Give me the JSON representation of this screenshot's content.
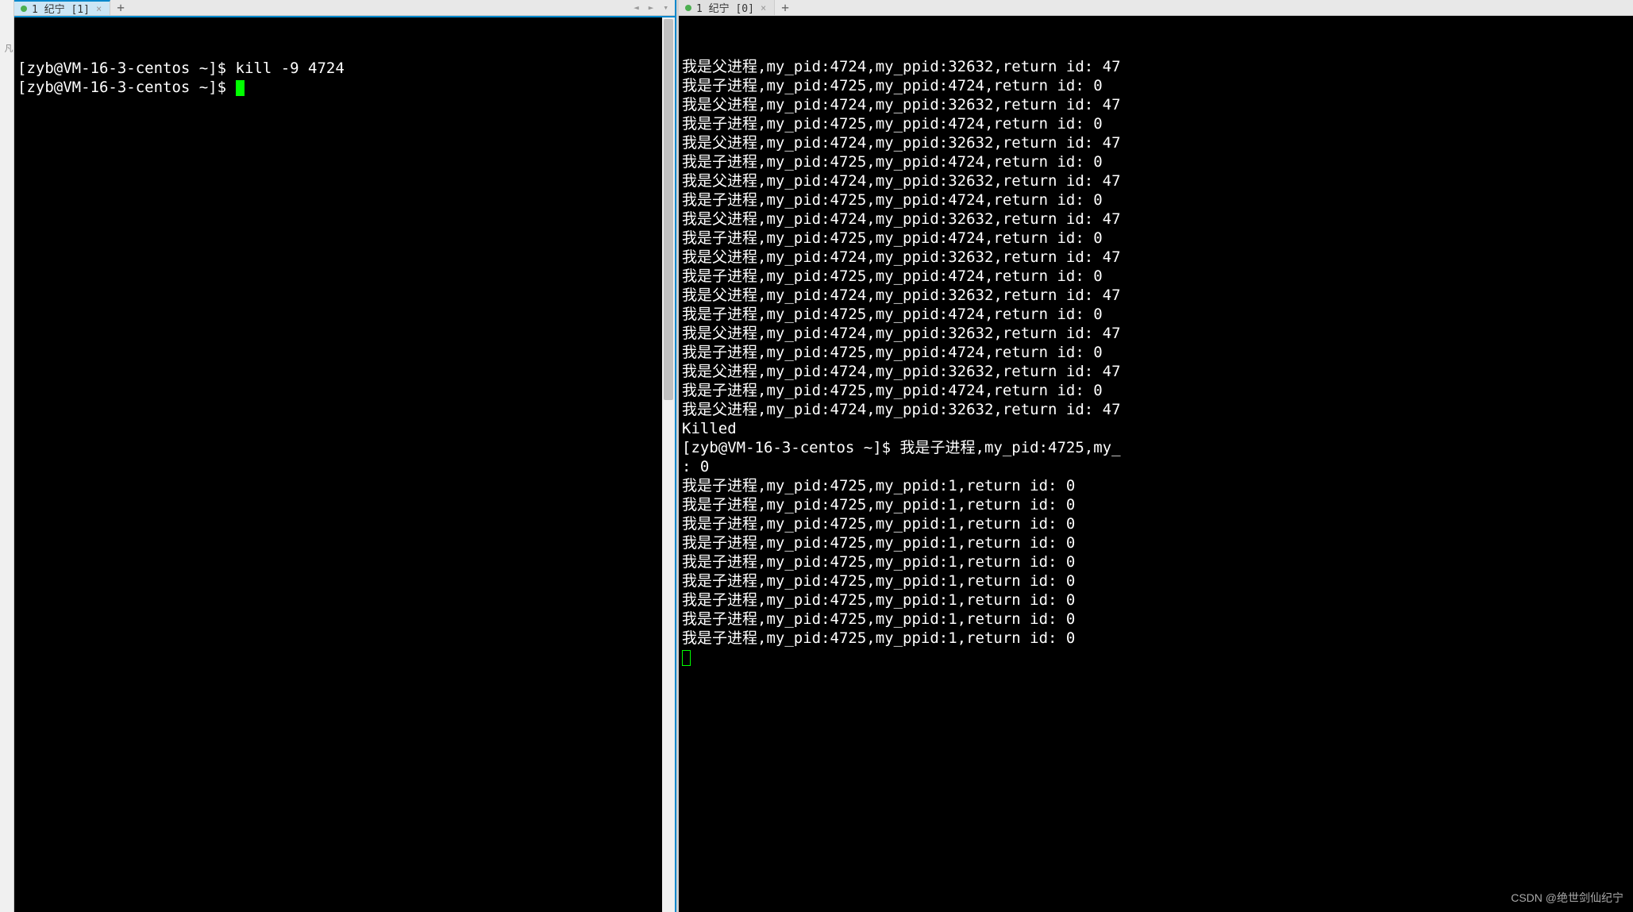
{
  "left_pane": {
    "tab": {
      "label": "1 纪宁 [1]",
      "active": true
    },
    "terminal": {
      "prompt": "[zyb@VM-16-3-centos ~]$",
      "lines": [
        "[zyb@VM-16-3-centos ~]$ kill -9 4724",
        "[zyb@VM-16-3-centos ~]$ "
      ],
      "command": "kill -9 4724"
    }
  },
  "right_pane": {
    "tab": {
      "label": "1 纪宁 [0]",
      "active": true
    },
    "terminal": {
      "prompt": "[zyb@VM-16-3-centos ~]$",
      "lines": [
        "我是父进程,my_pid:4724,my_ppid:32632,return id: 47",
        "我是子进程,my_pid:4725,my_ppid:4724,return id: 0",
        "我是父进程,my_pid:4724,my_ppid:32632,return id: 47",
        "我是子进程,my_pid:4725,my_ppid:4724,return id: 0",
        "我是父进程,my_pid:4724,my_ppid:32632,return id: 47",
        "我是子进程,my_pid:4725,my_ppid:4724,return id: 0",
        "我是父进程,my_pid:4724,my_ppid:32632,return id: 47",
        "我是子进程,my_pid:4725,my_ppid:4724,return id: 0",
        "我是父进程,my_pid:4724,my_ppid:32632,return id: 47",
        "我是子进程,my_pid:4725,my_ppid:4724,return id: 0",
        "我是父进程,my_pid:4724,my_ppid:32632,return id: 47",
        "我是子进程,my_pid:4725,my_ppid:4724,return id: 0",
        "我是父进程,my_pid:4724,my_ppid:32632,return id: 47",
        "我是子进程,my_pid:4725,my_ppid:4724,return id: 0",
        "我是父进程,my_pid:4724,my_ppid:32632,return id: 47",
        "我是子进程,my_pid:4725,my_ppid:4724,return id: 0",
        "我是父进程,my_pid:4724,my_ppid:32632,return id: 47",
        "我是子进程,my_pid:4725,my_ppid:4724,return id: 0",
        "我是父进程,my_pid:4724,my_ppid:32632,return id: 47",
        "Killed",
        "[zyb@VM-16-3-centos ~]$ 我是子进程,my_pid:4725,my_",
        ": 0",
        "我是子进程,my_pid:4725,my_ppid:1,return id: 0",
        "我是子进程,my_pid:4725,my_ppid:1,return id: 0",
        "我是子进程,my_pid:4725,my_ppid:1,return id: 0",
        "我是子进程,my_pid:4725,my_ppid:1,return id: 0",
        "我是子进程,my_pid:4725,my_ppid:1,return id: 0",
        "我是子进程,my_pid:4725,my_ppid:1,return id: 0",
        "我是子进程,my_pid:4725,my_ppid:1,return id: 0",
        "我是子进程,my_pid:4725,my_ppid:1,return id: 0",
        "我是子进程,my_pid:4725,my_ppid:1,return id: 0"
      ]
    }
  },
  "watermark": "CSDN @绝世剑仙纪宁",
  "gutter_marker": "凡",
  "nav": {
    "prev": "◄",
    "next": "►",
    "dropdown": "▾"
  },
  "icons": {
    "add": "+",
    "close": "×"
  }
}
